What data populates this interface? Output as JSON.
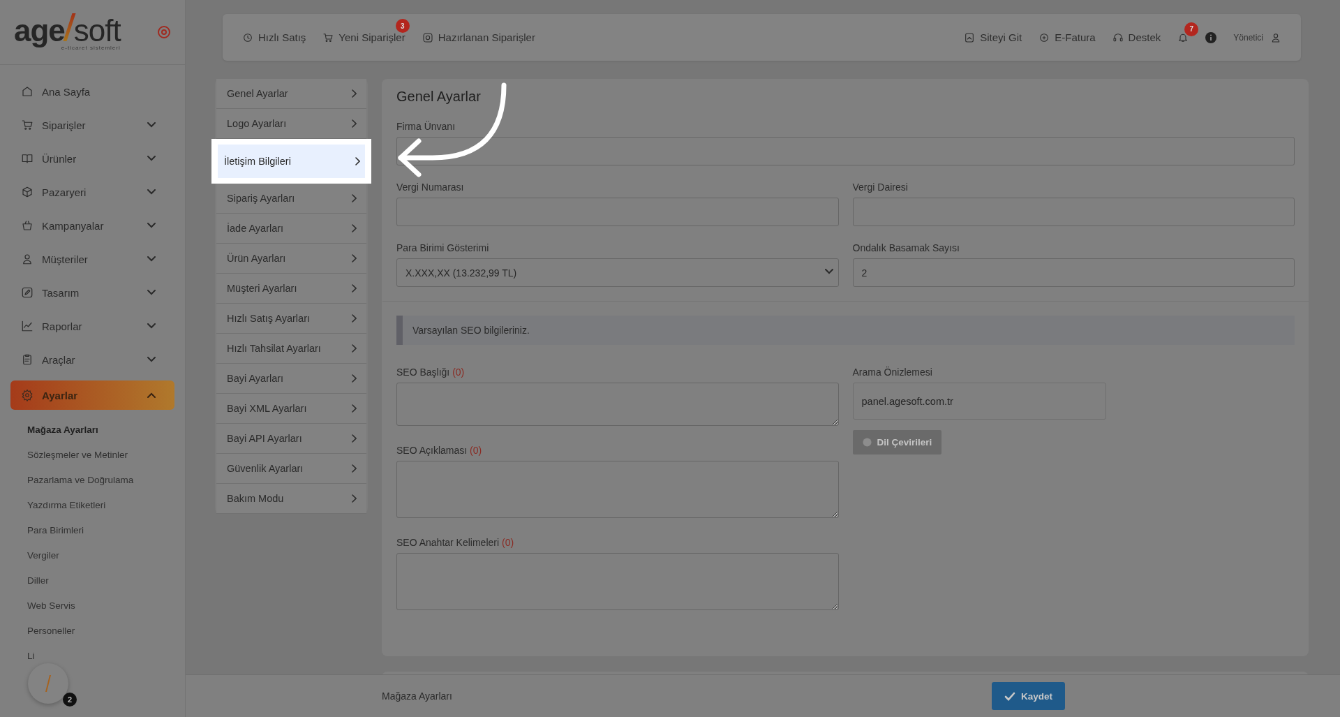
{
  "brand": {
    "left": "age",
    "right": "soft",
    "tagline": "e-ticaret sistemleri"
  },
  "sidebar": {
    "items": [
      {
        "label": "Ana Sayfa",
        "kind": "link",
        "selected": false
      },
      {
        "label": "Siparişler",
        "kind": "group",
        "selected": false,
        "expanded": false
      },
      {
        "label": "Ürünler",
        "kind": "group",
        "selected": false,
        "expanded": false
      },
      {
        "label": "Pazaryeri",
        "kind": "group",
        "selected": false,
        "expanded": false
      },
      {
        "label": "Kampanyalar",
        "kind": "group",
        "selected": false,
        "expanded": false
      },
      {
        "label": "Müşteriler",
        "kind": "group",
        "selected": false,
        "expanded": false
      },
      {
        "label": "Tasarım",
        "kind": "group",
        "selected": false,
        "expanded": false
      },
      {
        "label": "Raporlar",
        "kind": "group",
        "selected": false,
        "expanded": false
      },
      {
        "label": "Araçlar",
        "kind": "group",
        "selected": false,
        "expanded": false
      },
      {
        "label": "Ayarlar",
        "kind": "group",
        "selected": true,
        "expanded": true,
        "children": [
          {
            "label": "Mağaza Ayarları",
            "selected": true
          },
          {
            "label": "Sözleşmeler ve Metinler",
            "selected": false
          },
          {
            "label": "Pazarlama ve Doğrulama",
            "selected": false
          },
          {
            "label": "Yazdırma Etiketleri",
            "selected": false
          },
          {
            "label": "Para Birimleri",
            "selected": false
          },
          {
            "label": "Vergiler",
            "selected": false
          },
          {
            "label": "Diller",
            "selected": false
          },
          {
            "label": "Web Servis",
            "selected": false
          },
          {
            "label": "Personeller",
            "selected": false
          },
          {
            "label": "Li",
            "selected": false
          }
        ]
      }
    ]
  },
  "help_widget": {
    "badge": "2"
  },
  "topbar": {
    "left": [
      {
        "label": "Hızlı Satış"
      },
      {
        "label": "Yeni Siparişler",
        "badge": "3"
      },
      {
        "label": "Hazırlanan Siparişler"
      }
    ],
    "right": [
      {
        "kind": "link",
        "label": "Siteyi Git"
      },
      {
        "kind": "link",
        "label": "E-Fatura"
      },
      {
        "kind": "link",
        "label": "Destek"
      },
      {
        "kind": "bell",
        "badge": "7"
      },
      {
        "kind": "info"
      },
      {
        "kind": "user",
        "label": "Yönetici"
      }
    ]
  },
  "settings_menu": {
    "items": [
      {
        "label": "Genel Ayarlar",
        "selected": false
      },
      {
        "label": "Logo Ayarları",
        "selected": false
      },
      {
        "label": "İletişim Bilgileri",
        "selected": true
      },
      {
        "label": "Sipariş Ayarları",
        "selected": false
      },
      {
        "label": "İade Ayarları",
        "selected": false
      },
      {
        "label": "Ürün Ayarları",
        "selected": false
      },
      {
        "label": "Müşteri Ayarları",
        "selected": false
      },
      {
        "label": "Hızlı Satış Ayarları",
        "selected": false
      },
      {
        "label": "Hızlı Tahsilat Ayarları",
        "selected": false
      },
      {
        "label": "Bayi Ayarları",
        "selected": false
      },
      {
        "label": "Bayi XML Ayarları",
        "selected": false
      },
      {
        "label": "Bayi API Ayarları",
        "selected": false
      },
      {
        "label": "Güvenlik Ayarları",
        "selected": false
      },
      {
        "label": "Bakım Modu",
        "selected": false
      }
    ]
  },
  "form": {
    "title": "Genel Ayarlar",
    "full_field": {
      "label": "Firma Ünvanı",
      "kind": "text"
    },
    "grid_fields": [
      {
        "label": "Vergi Numarası",
        "kind": "text"
      },
      {
        "label": "Vergi Dairesi",
        "kind": "text"
      },
      {
        "label": "Para Birimi Gösterimi",
        "kind": "select",
        "value": "X.XXX,XX (13.232,99 TL)"
      },
      {
        "label": "Ondalık Basamak Sayısı",
        "kind": "text",
        "value": "2"
      }
    ],
    "seo_banner": "Varsayılan SEO bilgileriniz.",
    "seo_fields": [
      {
        "label": "SEO Başlığı",
        "count": "(0)"
      },
      {
        "label": "SEO Açıklaması",
        "count": "(0)"
      },
      {
        "label": "SEO Anahtar Kelimeleri",
        "count": "(0)"
      }
    ],
    "preview": {
      "label": "Arama Önizlemesi",
      "value": "panel.agesoft.com.tr",
      "button": {
        "label": "Dil Çevirileri",
        "disabled": true
      }
    }
  },
  "footer": {
    "title": "Mağaza Ayarları",
    "save": "Kaydet"
  }
}
